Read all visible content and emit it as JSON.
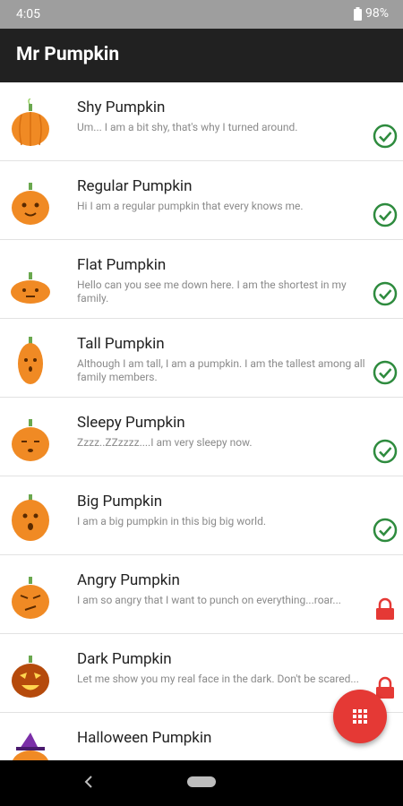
{
  "status_bar": {
    "time": "4:05",
    "battery": "98%"
  },
  "app_bar": {
    "title": "Mr Pumpkin"
  },
  "list": [
    {
      "name": "Shy Pumpkin",
      "description": "Um... I am a bit shy, that's why I turned around.",
      "state": "unlocked"
    },
    {
      "name": "Regular Pumpkin",
      "description": "Hi I am a regular pumpkin that every knows me.",
      "state": "unlocked"
    },
    {
      "name": "Flat Pumpkin",
      "description": "Hello can you see me down here. I am the shortest in my family.",
      "state": "unlocked"
    },
    {
      "name": "Tall Pumpkin",
      "description": "Although I am tall, I am a pumpkin. I am the tallest among all family members.",
      "state": "unlocked"
    },
    {
      "name": "Sleepy Pumpkin",
      "description": "Zzzz..ZZzzzz....I am very sleepy now.",
      "state": "unlocked"
    },
    {
      "name": "Big Pumpkin",
      "description": "I am a big pumpkin in this big big world.",
      "state": "unlocked"
    },
    {
      "name": "Angry Pumpkin",
      "description": "I am so angry that I want to punch on everything...roar...",
      "state": "locked"
    },
    {
      "name": "Dark Pumpkin",
      "description": "Let me show you my real face in the dark. Don't be scared...",
      "state": "locked"
    },
    {
      "name": "Halloween Pumpkin",
      "description": "",
      "state": "unknown"
    }
  ],
  "colors": {
    "check": "#2e8b3e",
    "lock": "#e53935",
    "pumpkin": "#f08a24",
    "fab": "#e53935"
  }
}
